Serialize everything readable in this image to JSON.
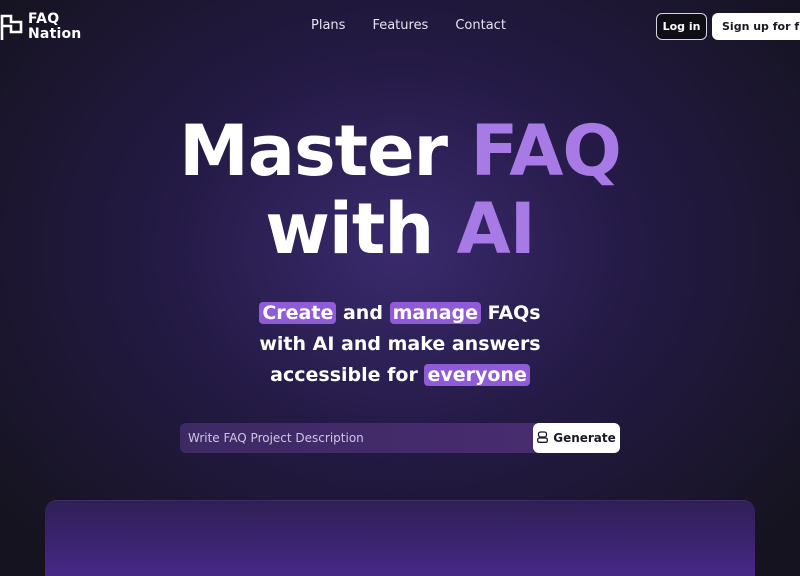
{
  "brand": {
    "line1": "FAQ",
    "line2": "Nation",
    "logo_icon": "flag-icon"
  },
  "nav": {
    "links": [
      "Plans",
      "Features",
      "Contact"
    ],
    "login_label": "Log in",
    "signup_label": "Sign up for free"
  },
  "hero": {
    "title_w1": "Master",
    "title_w2": "FAQ",
    "title_w3": "with",
    "title_w4": "AI",
    "sub_create": "Create",
    "sub_and": "and",
    "sub_manage": "manage",
    "sub_faqs": "FAQs",
    "sub_line2": "with AI and make answers",
    "sub_accessible": "accessible for",
    "sub_everyone": "everyone"
  },
  "search": {
    "placeholder": "Write FAQ Project Description",
    "value": "",
    "generate_label": "Generate",
    "generate_icon": "robot-icon"
  },
  "colors": {
    "accent": "#a77ae6",
    "highlight": "#8f5bd6",
    "background": "#15131f"
  }
}
